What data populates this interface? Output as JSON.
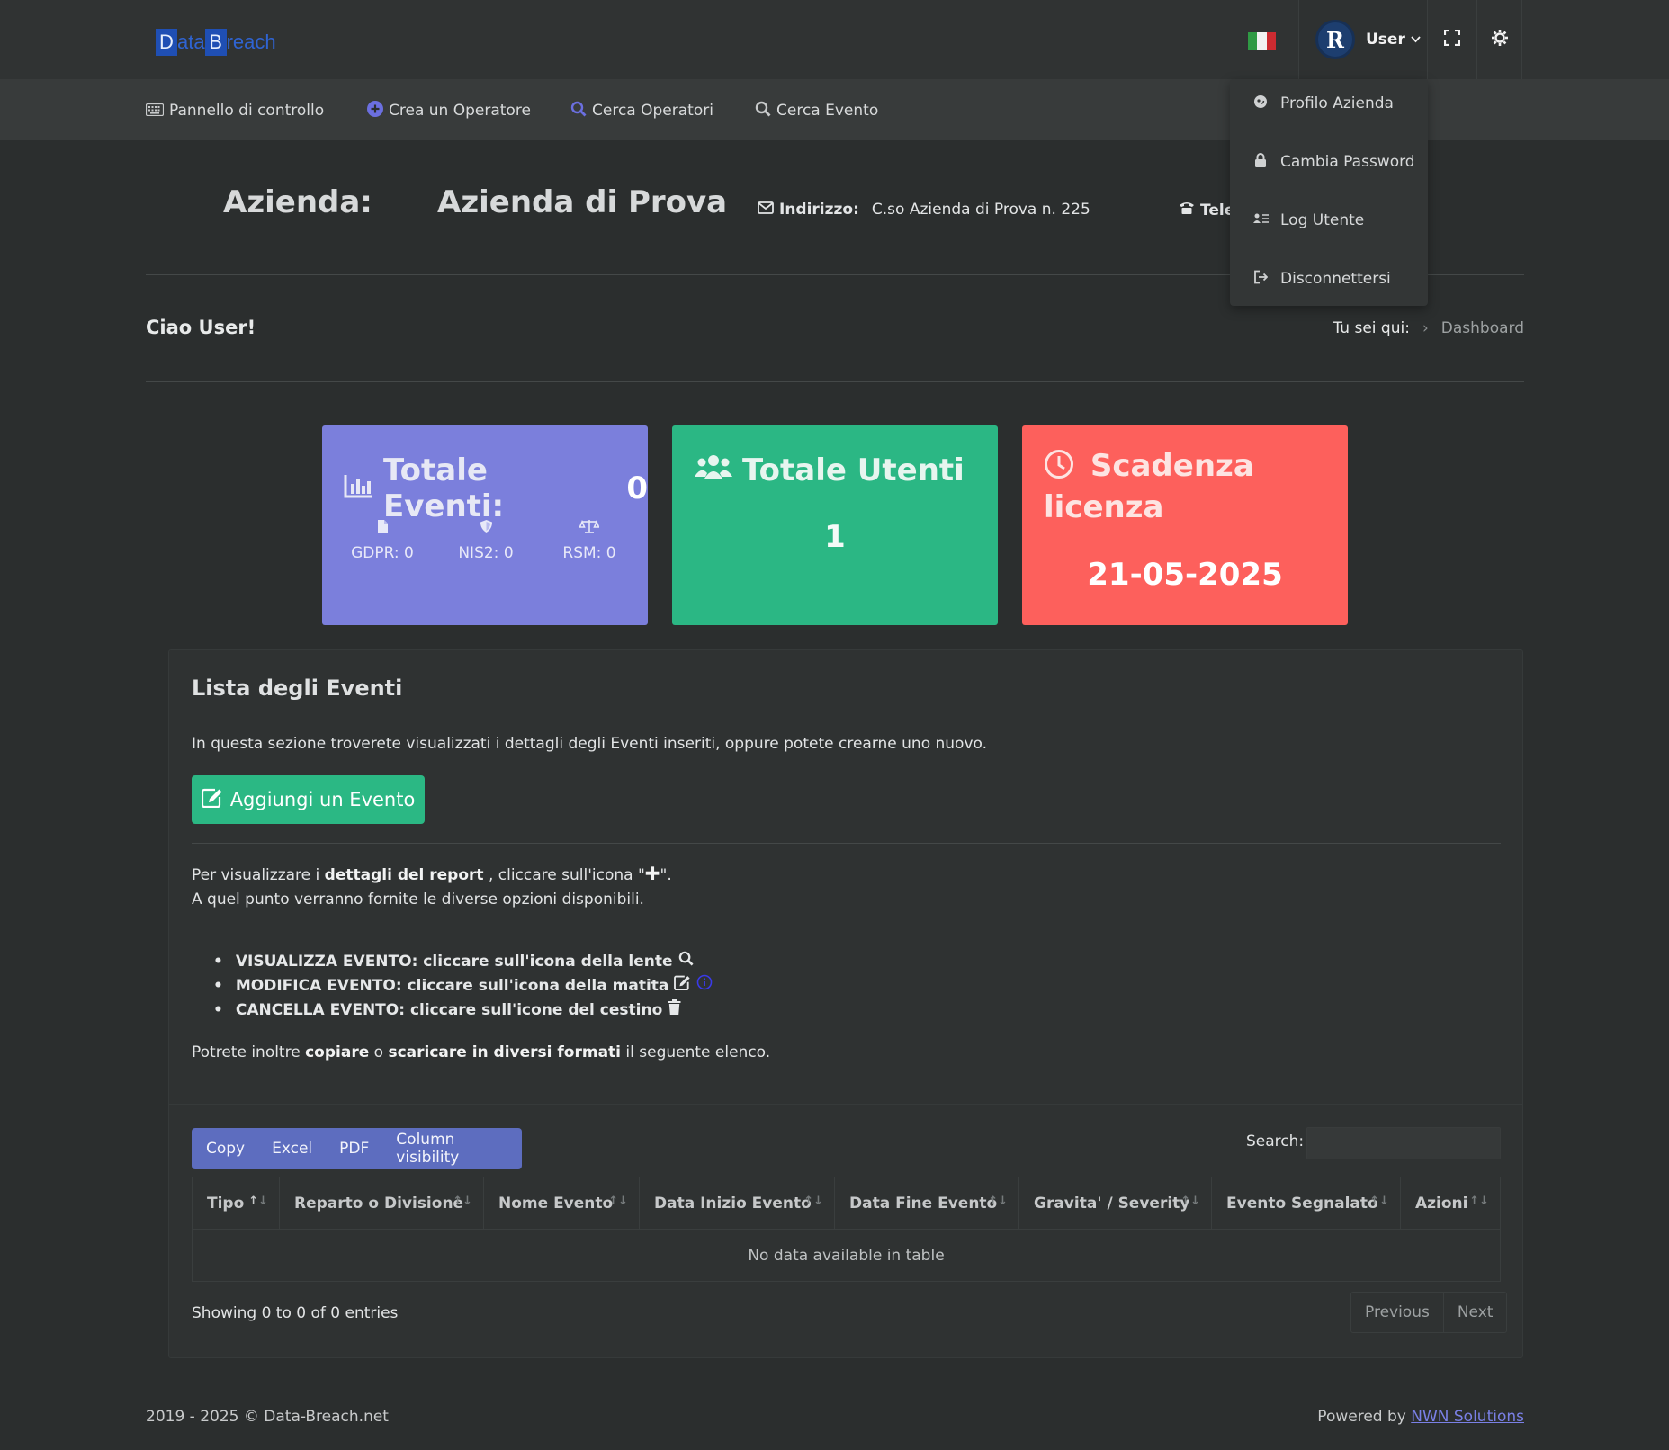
{
  "header": {
    "logo_box1": "D",
    "logo_text1": "ata",
    "logo_box2": "B",
    "logo_text2": "reach",
    "user_label": "User",
    "avatar_letter": "R"
  },
  "nav": [
    {
      "label": "Pannello di controllo",
      "icon": "keyboard-icon"
    },
    {
      "label": "Crea un Operatore",
      "icon": "plus-circle-icon"
    },
    {
      "label": "Cerca Operatori",
      "icon": "search-icon"
    },
    {
      "label": "Cerca Evento",
      "icon": "search-icon"
    }
  ],
  "user_menu": [
    {
      "label": "Profilo Azienda",
      "icon": "company-icon"
    },
    {
      "label": "Cambia Password",
      "icon": "lock-icon"
    },
    {
      "label": "Log Utente",
      "icon": "user-log-icon"
    },
    {
      "label": "Disconnettersi",
      "icon": "logout-icon"
    }
  ],
  "company": {
    "label": "Azienda:",
    "name": "Azienda di Prova",
    "address_label": "Indirizzo:",
    "address": "C.so Azienda di Prova n. 225",
    "phone_label": "Tele"
  },
  "greeting": "Ciao User!",
  "breadcrumb": {
    "label": "Tu sei qui:",
    "sep": "›",
    "current": "Dashboard"
  },
  "cards": {
    "events": {
      "title": "Totale Eventi:",
      "count": "0",
      "stats": [
        {
          "label": "GDPR: 0",
          "icon": "file-icon"
        },
        {
          "label": "NIS2: 0",
          "icon": "shield-icon"
        },
        {
          "label": "RSM: 0",
          "icon": "balance-scale-icon"
        }
      ]
    },
    "users": {
      "title": "Totale Utenti",
      "count": "1"
    },
    "license": {
      "title_line1": "Scadenza",
      "title_line2": "licenza",
      "date": "21-05-2025"
    }
  },
  "events_section": {
    "title": "Lista degli Eventi",
    "intro": "In questa sezione troverete visualizzati i dettagli degli Eventi inseriti, oppure potete crearne uno nuovo.",
    "add_button": "Aggiungi un Evento",
    "details_pre": "Per visualizzare i",
    "details_bold": "dettagli del report",
    "details_post": ", cliccare sull'icona \"",
    "details_end": "\".",
    "details_line2": "A quel punto verranno fornite le diverse opzioni disponibili.",
    "bullets": [
      "VISUALIZZA EVENTO: cliccare sull'icona della lente",
      "MODIFICA EVENTO: cliccare sull'icona della matita",
      "CANCELLA EVENTO: cliccare sull'icone del cestino"
    ],
    "copy_pre": "Potrete inoltre",
    "copy_bold1": "copiare",
    "copy_mid": "o",
    "copy_bold2": "scaricare in diversi formati",
    "copy_post": "il seguente elenco."
  },
  "table": {
    "buttons": [
      "Copy",
      "Excel",
      "PDF",
      "Column visibility"
    ],
    "search_label": "Search:",
    "columns": [
      "Tipo",
      "Reparto o Divisione",
      "Nome Evento",
      "Data Inizio Evento",
      "Data Fine Evento",
      "Gravita' / Severity",
      "Evento Segnalato",
      "Azioni"
    ],
    "empty": "No data available in table",
    "showing": "Showing 0 to 0 of 0 entries",
    "prev": "Previous",
    "next": "Next"
  },
  "footer": {
    "copyright": "2019 - 2025 © Data-Breach.net",
    "powered_pre": "Powered by",
    "powered_link": "NWN Solutions"
  },
  "colors": {
    "card_events": "#7b7fdc",
    "card_users": "#2bb784",
    "card_license": "#fd605c",
    "accent": "#6b6fe0"
  }
}
